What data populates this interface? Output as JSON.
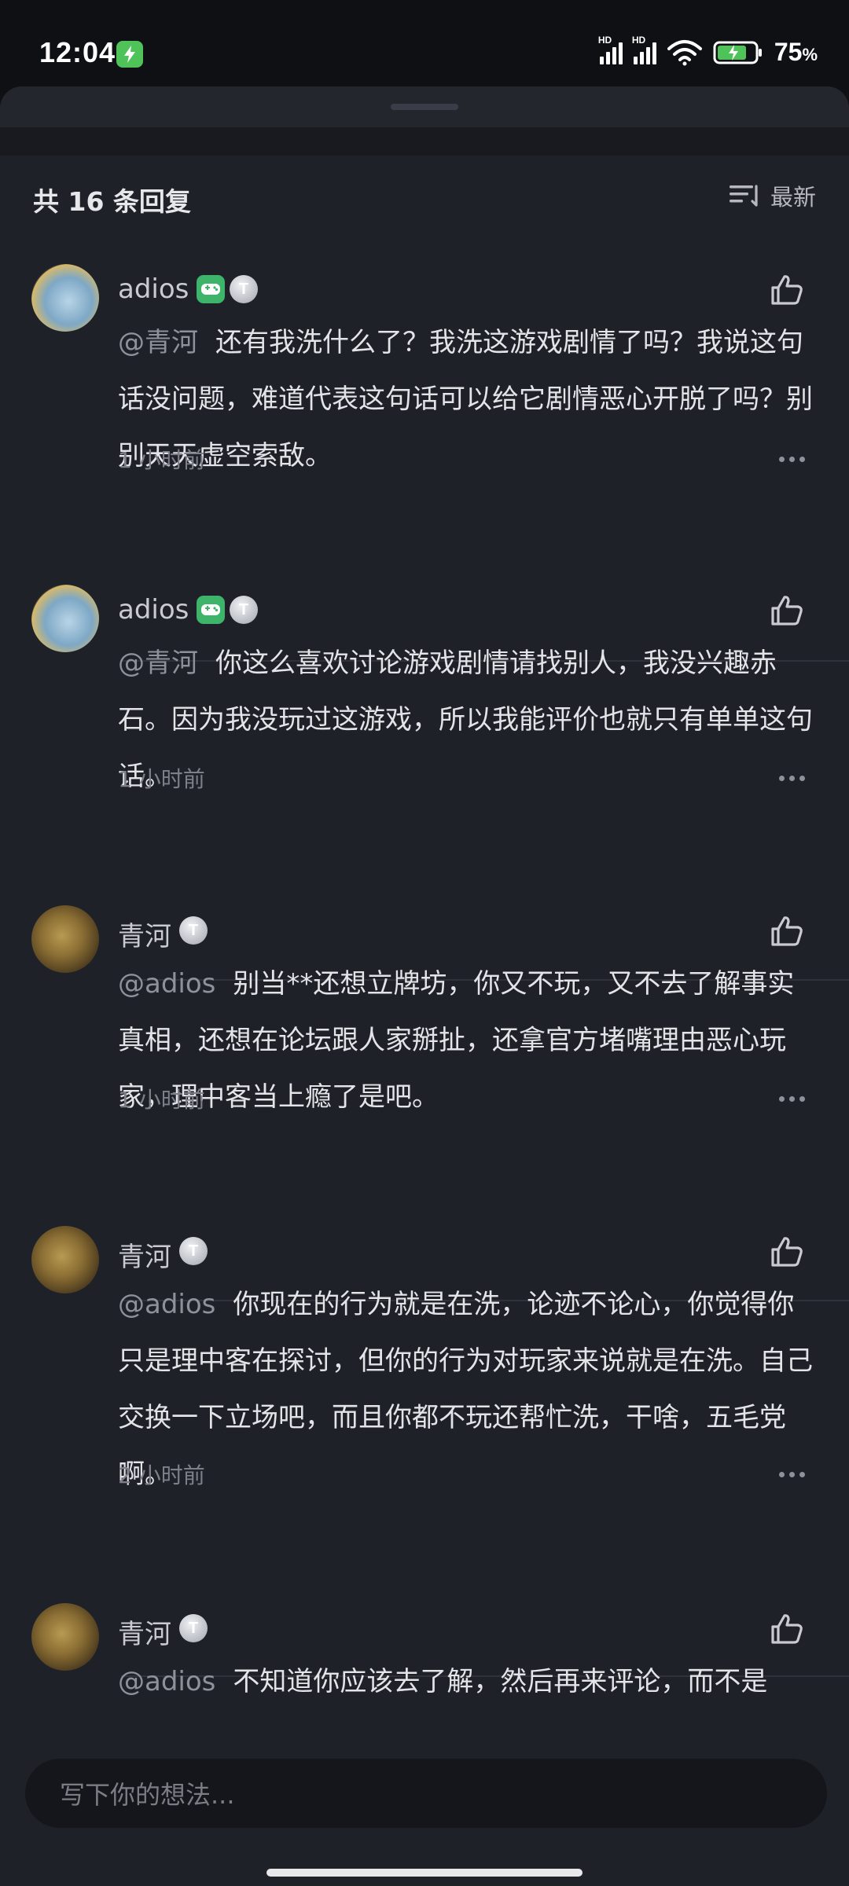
{
  "status_bar": {
    "time": "12:04",
    "network_label": "HD",
    "battery_value": "75",
    "battery_unit": "%"
  },
  "header": {
    "reply_count_text": "共 16 条回复",
    "sort_label": "最新"
  },
  "comments": [
    {
      "user": "adios",
      "mention": "@青河",
      "text": "还有我洗什么了？我洗这游戏剧情了吗？我说这句话没问题，难道代表这句话可以给它剧情恶心开脱了吗？别别天天虚空索敌。",
      "time": "1 小时前",
      "level": "T"
    },
    {
      "user": "adios",
      "mention": "@青河",
      "text": "你这么喜欢讨论游戏剧情请找别人，我没兴趣赤石。因为我没玩过这游戏，所以我能评价也就只有单单这句话。",
      "time": "1 小时前",
      "level": "T"
    },
    {
      "user": "青河",
      "mention": "@adios",
      "text": "别当**还想立牌坊，你又不玩，又不去了解事实真相，还想在论坛跟人家掰扯，还拿官方堵嘴理由恶心玩家，理中客当上瘾了是吧。",
      "time": "1 小时前",
      "level": "T"
    },
    {
      "user": "青河",
      "mention": "@adios",
      "text": "你现在的行为就是在洗，论迹不论心，你觉得你只是理中客在探讨，但你的行为对玩家来说就是在洗。自己交换一下立场吧，而且你都不玩还帮忙洗，干啥，五毛党啊。",
      "time": "2 小时前",
      "level": "T"
    },
    {
      "user": "青河",
      "mention": "@adios",
      "text": "不知道你应该去了解，然后再来评论，而不是",
      "time": "",
      "level": "T"
    }
  ],
  "input": {
    "placeholder": "写下你的想法..."
  }
}
